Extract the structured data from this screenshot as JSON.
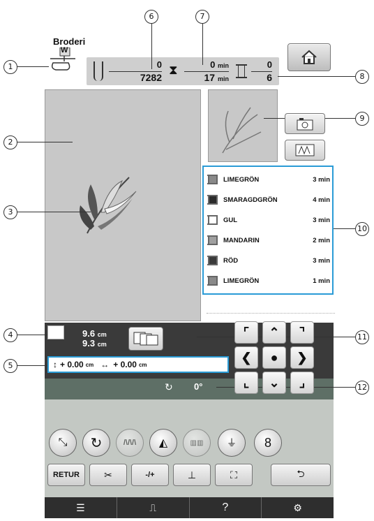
{
  "header": {
    "title": "Broderi",
    "foot_label": "W"
  },
  "callouts": [
    "1",
    "2",
    "3",
    "4",
    "5",
    "6",
    "7",
    "8",
    "9",
    "10",
    "11",
    "12"
  ],
  "stitch": {
    "current": "0",
    "total": "7282"
  },
  "time": {
    "current": "0",
    "current_unit": "min",
    "total": "17",
    "total_unit": "min"
  },
  "colors": {
    "current": "0",
    "total": "6"
  },
  "threads": [
    {
      "name": "LIMEGRÖN",
      "time": "3 min",
      "color": "#8a8a8a"
    },
    {
      "name": "SMARAGDGRÖN",
      "time": "4 min",
      "color": "#2b2b2b"
    },
    {
      "name": "GUL",
      "time": "3 min",
      "color": "#ffffff"
    },
    {
      "name": "MANDARIN",
      "time": "2 min",
      "color": "#a0a0a0"
    },
    {
      "name": "RÖD",
      "time": "3 min",
      "color": "#3a3a3a"
    },
    {
      "name": "LIMEGRÖN",
      "time": "1 min",
      "color": "#8a8a8a"
    }
  ],
  "size": {
    "height": "9.6",
    "width": "9.3",
    "unit": "cm"
  },
  "position": {
    "v": "+ 0.00",
    "h": "+ 0.00",
    "unit": "cm"
  },
  "rotation": {
    "value": "0°"
  },
  "buttons": {
    "retur": "RETUR",
    "needle": "-/+",
    "help": "?"
  },
  "accent": "#2a9bd6"
}
